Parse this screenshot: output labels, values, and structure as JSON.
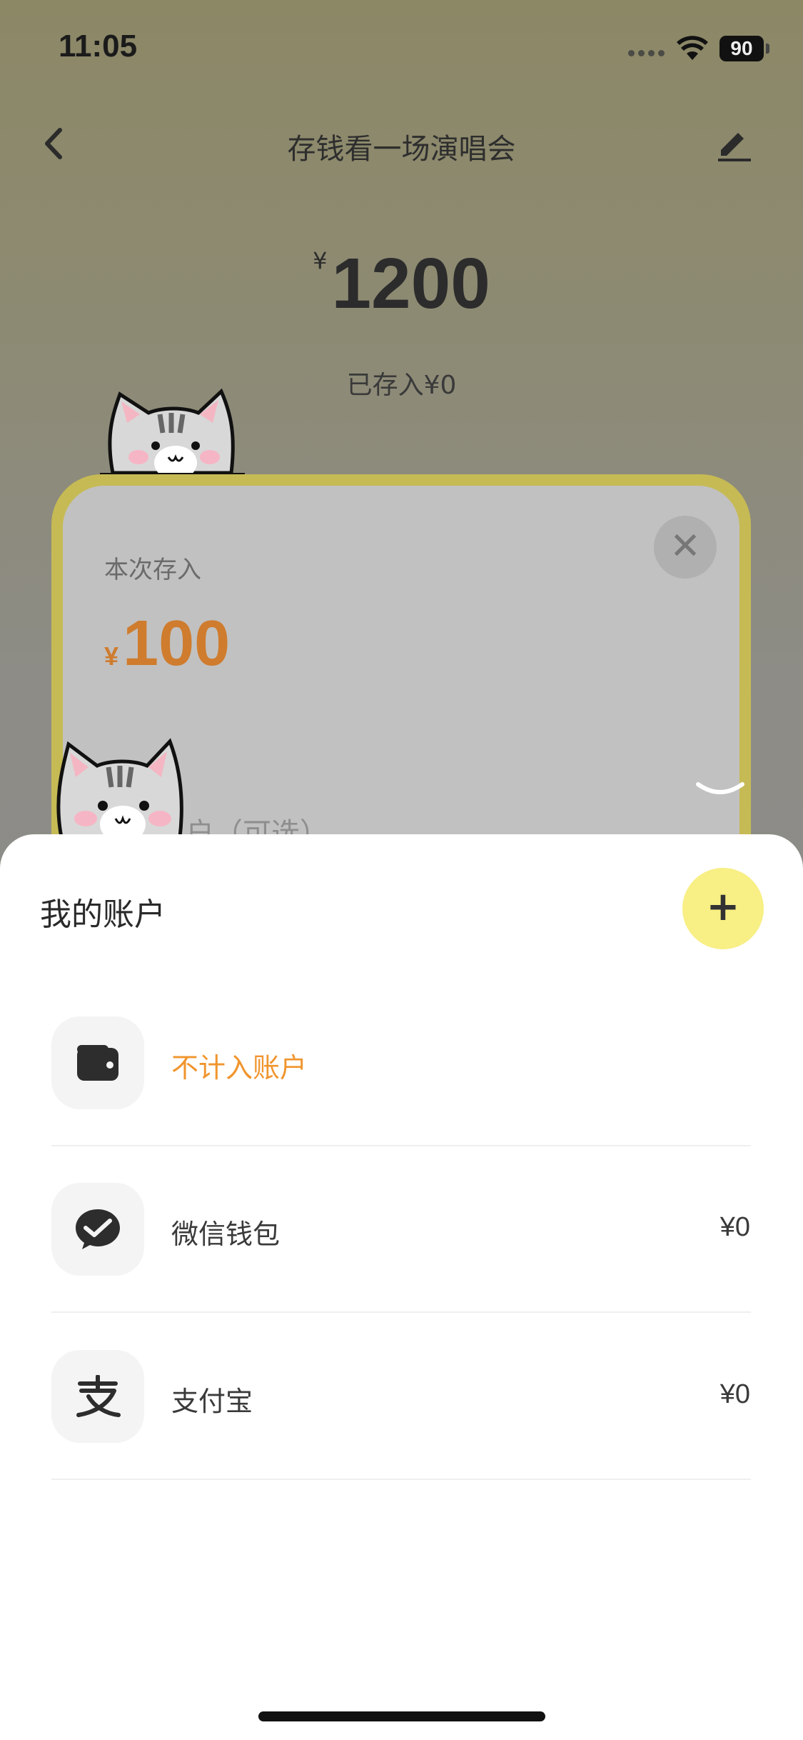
{
  "status_bar": {
    "time": "11:05",
    "battery": "90"
  },
  "header": {
    "title": "存钱看一场演唱会"
  },
  "goal": {
    "currency": "¥",
    "amount": "1200",
    "saved_text": "已存入¥0"
  },
  "deposit_card": {
    "label": "本次存入",
    "currency": "¥",
    "amount": "100",
    "account_hint": "户（可选）"
  },
  "accounts_sheet": {
    "title": "我的账户",
    "add_label": "+",
    "accounts": [
      {
        "name": "不计入账户",
        "balance": "",
        "icon": "wallet-icon",
        "highlight": true
      },
      {
        "name": "微信钱包",
        "balance": "¥0",
        "icon": "wechat-icon"
      },
      {
        "name": "支付宝",
        "balance": "¥0",
        "icon": "alipay-icon"
      }
    ]
  },
  "colors": {
    "accent_orange": "#cf7c2e",
    "highlight_orange": "#f0952e",
    "add_button_yellow": "#f8ef85",
    "card_border": "#c6ba55"
  }
}
